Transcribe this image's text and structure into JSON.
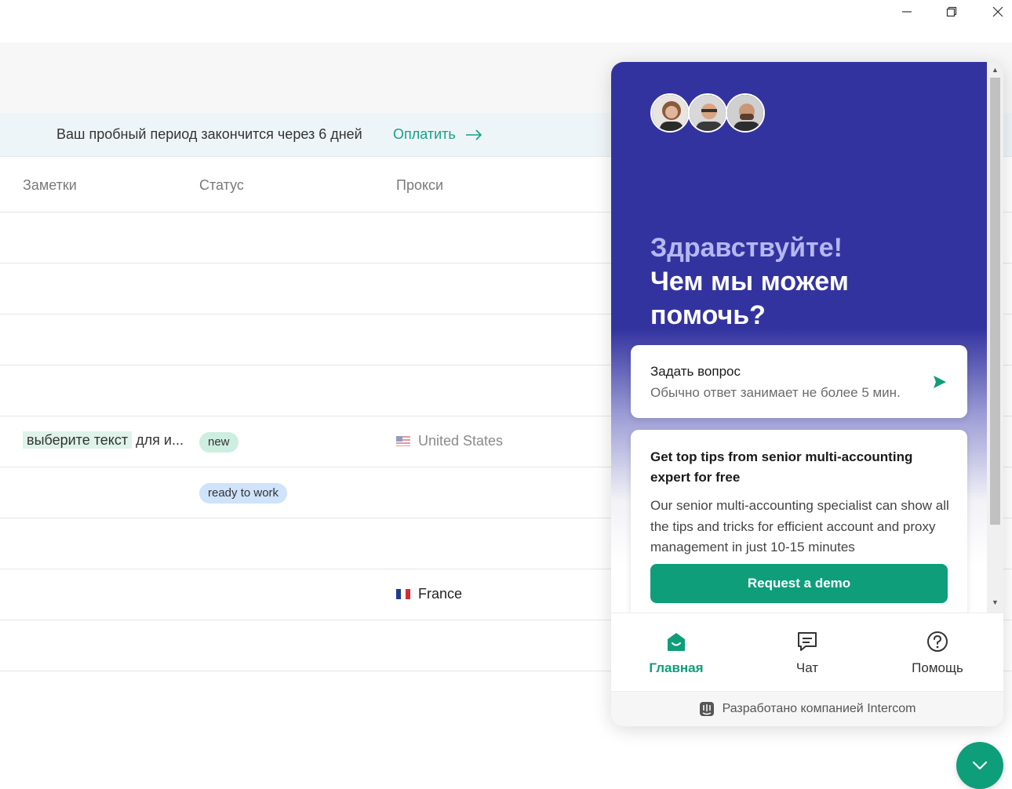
{
  "window": {
    "minimize_icon": "minimize-icon",
    "maximize_icon": "restore-icon",
    "close_icon": "close-icon"
  },
  "banner": {
    "text": "Ваш пробный период закончится через 6 дней",
    "link_label": "Оплатить"
  },
  "table": {
    "columns": [
      "Заметки",
      "Статус",
      "Прокси"
    ],
    "rows": [
      {
        "note_highlight": "",
        "note_rest": "",
        "status": "",
        "proxy": ""
      },
      {
        "note_highlight": "",
        "note_rest": "",
        "status": "",
        "proxy": ""
      },
      {
        "note_highlight": "",
        "note_rest": "",
        "status": "",
        "proxy": ""
      },
      {
        "note_highlight": "",
        "note_rest": "",
        "status": "",
        "proxy": ""
      },
      {
        "note_highlight": "выберите текст",
        "note_rest": "для и...",
        "status": "new",
        "proxy": "United States"
      },
      {
        "note_highlight": "",
        "note_rest": "",
        "status": "ready to work",
        "proxy": ""
      },
      {
        "note_highlight": "",
        "note_rest": "",
        "status": "",
        "proxy": ""
      },
      {
        "note_highlight": "",
        "note_rest": "",
        "status": "",
        "proxy": "France"
      },
      {
        "note_highlight": "",
        "note_rest": "",
        "status": "",
        "proxy": ""
      }
    ]
  },
  "messenger": {
    "greeting_hi": "Здравствуйте!",
    "greeting_help": "Чем мы можем помочь?",
    "ask_card": {
      "title": "Задать вопрос",
      "subtitle": "Обычно ответ занимает не более 5 мин."
    },
    "tips_card": {
      "title": "Get top tips from senior multi-accounting expert for free",
      "body": "Our senior multi-accounting specialist can show all the tips and tricks for efficient account and proxy management in just 10-15 minutes",
      "button": "Request a demo"
    },
    "tabs": [
      {
        "label": "Главная",
        "icon": "home-icon",
        "active": true
      },
      {
        "label": "Чат",
        "icon": "chat-icon",
        "active": false
      },
      {
        "label": "Помощь",
        "icon": "help-icon",
        "active": false
      }
    ],
    "powered_by": "Разработано компанией Intercom"
  },
  "colors": {
    "accent": "#0e9e7a",
    "messenger_header": "#3333a0",
    "badge_new": "#cdeee0",
    "badge_ready": "#cfe3fb"
  }
}
